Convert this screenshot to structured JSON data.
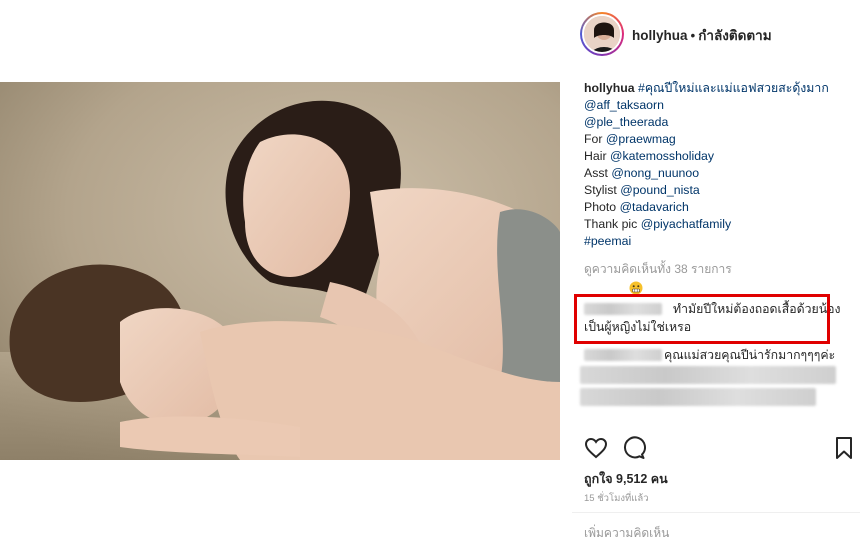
{
  "header": {
    "username": "hollyhua",
    "separator": "•",
    "follow_status": "กำลังติดตาม"
  },
  "caption": {
    "username": "hollyhua",
    "hashtag": "#คุณปีใหม่และแม่แอฟสวยสะดุ้งมาก",
    "lines": [
      {
        "prefix": "",
        "tag": "@aff_taksaorn"
      },
      {
        "prefix": "",
        "tag": "@ple_theerada"
      },
      {
        "prefix": "For ",
        "tag": "@praewmag"
      },
      {
        "prefix": "Hair ",
        "tag": "@katemossholiday"
      },
      {
        "prefix": "Asst ",
        "tag": "@nong_nuunoo"
      },
      {
        "prefix": "Stylist ",
        "tag": "@pound_nista"
      },
      {
        "prefix": "Photo ",
        "tag": "@tadavarich"
      },
      {
        "prefix": "Thank pic ",
        "tag": "@piyachatfamily"
      },
      {
        "prefix": "",
        "tag": "#peemai"
      }
    ]
  },
  "comments": {
    "view_all": "ดูความคิดเห็นทั้ง 38 รายการ",
    "highlighted_line1": "ทำมัยปีใหม่ต้องถอดเสื้อด้วยน้อง",
    "highlighted_line2": "เป็นผู้หญิงไม่ใช่เหรอ",
    "second": "คุณแม่สวยคุณปีน่ารักมากๆๆๆค่ะ"
  },
  "post": {
    "likes": "ถูกใจ 9,512 คน",
    "time": "15 ชั่วโมงที่แล้ว",
    "add_comment_placeholder": "เพิ่มความคิดเห็น"
  },
  "icons": {
    "like": "heart-icon",
    "comment": "comment-icon",
    "save": "bookmark-icon",
    "emoji": "grimace-emoji-icon"
  },
  "colors": {
    "tag": "#003569",
    "highlight": "#e00000",
    "muted": "#999999"
  }
}
